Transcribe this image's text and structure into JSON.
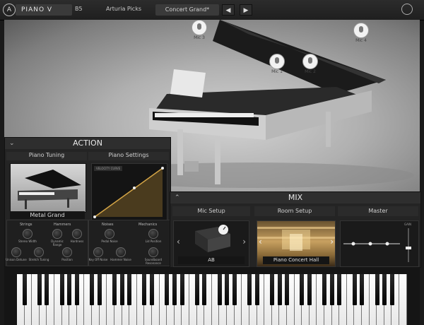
{
  "topbar": {
    "app_name": "PIANO V",
    "bank_label": "B5",
    "preset_owner": "Arturia Picks",
    "preset_name": "Concert Grand*",
    "prev_icon": "triangle-left",
    "next_icon": "triangle-right",
    "settings_icon": "gear-icon"
  },
  "mics": [
    "Mic 3",
    "Mic 1",
    "Mic 2",
    "Mic 4"
  ],
  "action": {
    "title": "ACTION",
    "tabs": [
      "Piano Tuning",
      "Piano Settings"
    ],
    "piano_name": "Metal Grand",
    "velocity_curve_label": "VELOCITY CURVE",
    "strings": {
      "title": "Strings",
      "knobs": [
        "Stereo Width",
        "Unison Detune",
        "Stretch Tuning"
      ]
    },
    "hammers": {
      "title": "Hammers",
      "knobs": [
        "Dynamic Range",
        "Hardness",
        "Position"
      ]
    },
    "noises": {
      "title": "Noises",
      "knobs": [
        "Pedal Noise",
        "Key Off Noise",
        "Hammer Noise"
      ]
    },
    "mechanics": {
      "title": "Mechanics",
      "knobs": [
        "Lid Position",
        "Soundboard Resonance"
      ]
    }
  },
  "mix": {
    "title": "MIX",
    "tabs": [
      "Mic Setup",
      "Room Setup",
      "Master"
    ],
    "mic_setup_value": "AB",
    "room_value": "Piano Concert Hall",
    "master_gain_label": "GAIN"
  },
  "colors": {
    "accent": "#d4a546",
    "panel": "#242424",
    "bg": "#1a1a1a"
  }
}
